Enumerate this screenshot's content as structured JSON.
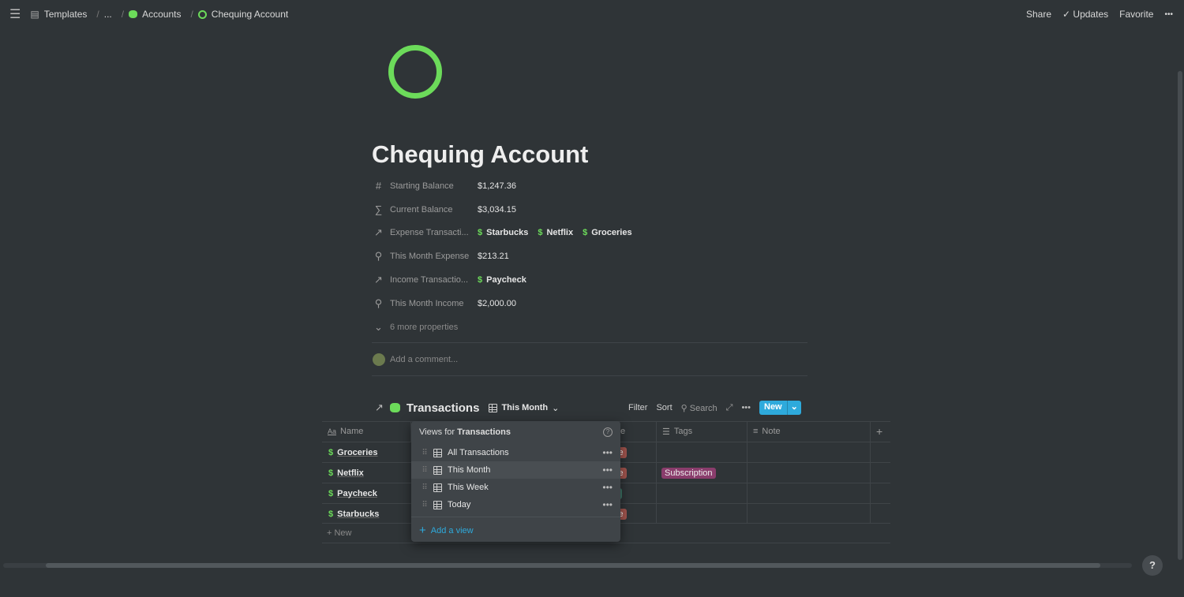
{
  "breadcrumb": {
    "items": [
      "Templates",
      "...",
      "Accounts",
      "Chequing Account"
    ]
  },
  "topbar": {
    "share": "Share",
    "updates": "Updates",
    "favorite": "Favorite",
    "more": "•••"
  },
  "page": {
    "title": "Chequing Account",
    "icon": "green-ring-icon",
    "properties": [
      {
        "icon": "#",
        "label": "Starting Balance",
        "value": "$1,247.36"
      },
      {
        "icon": "∑",
        "label": "Current Balance",
        "value": "$3,034.15"
      },
      {
        "icon": "↗",
        "label": "Expense Transacti...",
        "relations": [
          "Starbucks",
          "Netflix",
          "Groceries"
        ]
      },
      {
        "icon": "⚲",
        "label": "This Month Expense",
        "value": "$213.21"
      },
      {
        "icon": "↗",
        "label": "Income Transactio...",
        "relations": [
          "Paycheck"
        ]
      },
      {
        "icon": "⚲",
        "label": "This Month Income",
        "value": "$2,000.00"
      }
    ],
    "more_properties": "6 more properties",
    "comment_placeholder": "Add a comment..."
  },
  "db": {
    "title": "Transactions",
    "view": "This Month",
    "filter": "Filter",
    "sort": "Sort",
    "search": "Search",
    "new": "New",
    "columns": {
      "name": "Name",
      "type_fragment": "e",
      "tags": "Tags",
      "note": "Note"
    },
    "rows": [
      {
        "name": "Groceries",
        "type": "se",
        "type_color": "#a0534d",
        "tag": ""
      },
      {
        "name": "Netflix",
        "type": "se",
        "type_color": "#a0534d",
        "tag": "Subscription"
      },
      {
        "name": "Paycheck",
        "type": "e",
        "type_color": "#3d7467",
        "tag": ""
      },
      {
        "name": "Starbucks",
        "type": "se",
        "type_color": "#a0534d",
        "tag": ""
      }
    ],
    "new_row": "New",
    "tag_color": "#8a3d6c",
    "accent": "#2eaadc"
  },
  "views_popup": {
    "title_prefix": "Views for ",
    "title_db": "Transactions",
    "help": "?",
    "views": [
      "All Transactions",
      "This Month",
      "This Week",
      "Today"
    ],
    "selected": "This Month",
    "add": "Add a view"
  },
  "help_button": "?"
}
